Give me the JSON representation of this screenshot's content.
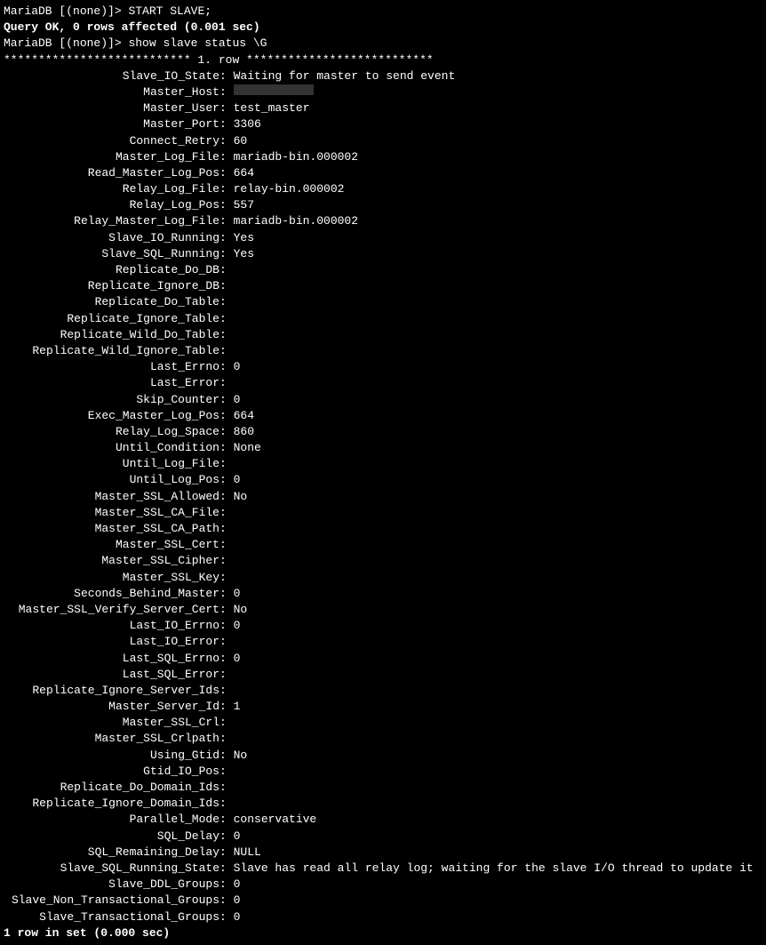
{
  "prompt1": "MariaDB [(none)]> ",
  "cmd1": "START SLAVE;",
  "result1": "Query OK, 0 rows affected (0.001 sec)",
  "blank": "",
  "prompt2": "MariaDB [(none)]> ",
  "cmd2": "show slave status \\G",
  "row_divider": "*************************** 1. row ***************************",
  "sep": ": ",
  "fields": {
    "f0": {
      "label": "Slave_IO_State",
      "value": "Waiting for master to send event"
    },
    "f1": {
      "label": "Master_Host",
      "value": ""
    },
    "f2": {
      "label": "Master_User",
      "value": "test_master"
    },
    "f3": {
      "label": "Master_Port",
      "value": "3306"
    },
    "f4": {
      "label": "Connect_Retry",
      "value": "60"
    },
    "f5": {
      "label": "Master_Log_File",
      "value": "mariadb-bin.000002"
    },
    "f6": {
      "label": "Read_Master_Log_Pos",
      "value": "664"
    },
    "f7": {
      "label": "Relay_Log_File",
      "value": "relay-bin.000002"
    },
    "f8": {
      "label": "Relay_Log_Pos",
      "value": "557"
    },
    "f9": {
      "label": "Relay_Master_Log_File",
      "value": "mariadb-bin.000002"
    },
    "f10": {
      "label": "Slave_IO_Running",
      "value": "Yes"
    },
    "f11": {
      "label": "Slave_SQL_Running",
      "value": "Yes"
    },
    "f12": {
      "label": "Replicate_Do_DB",
      "value": ""
    },
    "f13": {
      "label": "Replicate_Ignore_DB",
      "value": ""
    },
    "f14": {
      "label": "Replicate_Do_Table",
      "value": ""
    },
    "f15": {
      "label": "Replicate_Ignore_Table",
      "value": ""
    },
    "f16": {
      "label": "Replicate_Wild_Do_Table",
      "value": ""
    },
    "f17": {
      "label": "Replicate_Wild_Ignore_Table",
      "value": ""
    },
    "f18": {
      "label": "Last_Errno",
      "value": "0"
    },
    "f19": {
      "label": "Last_Error",
      "value": ""
    },
    "f20": {
      "label": "Skip_Counter",
      "value": "0"
    },
    "f21": {
      "label": "Exec_Master_Log_Pos",
      "value": "664"
    },
    "f22": {
      "label": "Relay_Log_Space",
      "value": "860"
    },
    "f23": {
      "label": "Until_Condition",
      "value": "None"
    },
    "f24": {
      "label": "Until_Log_File",
      "value": ""
    },
    "f25": {
      "label": "Until_Log_Pos",
      "value": "0"
    },
    "f26": {
      "label": "Master_SSL_Allowed",
      "value": "No"
    },
    "f27": {
      "label": "Master_SSL_CA_File",
      "value": ""
    },
    "f28": {
      "label": "Master_SSL_CA_Path",
      "value": ""
    },
    "f29": {
      "label": "Master_SSL_Cert",
      "value": ""
    },
    "f30": {
      "label": "Master_SSL_Cipher",
      "value": ""
    },
    "f31": {
      "label": "Master_SSL_Key",
      "value": ""
    },
    "f32": {
      "label": "Seconds_Behind_Master",
      "value": "0"
    },
    "f33": {
      "label": "Master_SSL_Verify_Server_Cert",
      "value": "No"
    },
    "f34": {
      "label": "Last_IO_Errno",
      "value": "0"
    },
    "f35": {
      "label": "Last_IO_Error",
      "value": ""
    },
    "f36": {
      "label": "Last_SQL_Errno",
      "value": "0"
    },
    "f37": {
      "label": "Last_SQL_Error",
      "value": ""
    },
    "f38": {
      "label": "Replicate_Ignore_Server_Ids",
      "value": ""
    },
    "f39": {
      "label": "Master_Server_Id",
      "value": "1"
    },
    "f40": {
      "label": "Master_SSL_Crl",
      "value": ""
    },
    "f41": {
      "label": "Master_SSL_Crlpath",
      "value": ""
    },
    "f42": {
      "label": "Using_Gtid",
      "value": "No"
    },
    "f43": {
      "label": "Gtid_IO_Pos",
      "value": ""
    },
    "f44": {
      "label": "Replicate_Do_Domain_Ids",
      "value": ""
    },
    "f45": {
      "label": "Replicate_Ignore_Domain_Ids",
      "value": ""
    },
    "f46": {
      "label": "Parallel_Mode",
      "value": "conservative"
    },
    "f47": {
      "label": "SQL_Delay",
      "value": "0"
    },
    "f48": {
      "label": "SQL_Remaining_Delay",
      "value": "NULL"
    },
    "f49": {
      "label": "Slave_SQL_Running_State",
      "value": "Slave has read all relay log; waiting for the slave I/O thread to update it"
    },
    "f50": {
      "label": "Slave_DDL_Groups",
      "value": "0"
    },
    "f51": {
      "label": "Slave_Non_Transactional_Groups",
      "value": "0"
    },
    "f52": {
      "label": "Slave_Transactional_Groups",
      "value": "0"
    }
  },
  "footer": "1 row in set (0.000 sec)"
}
